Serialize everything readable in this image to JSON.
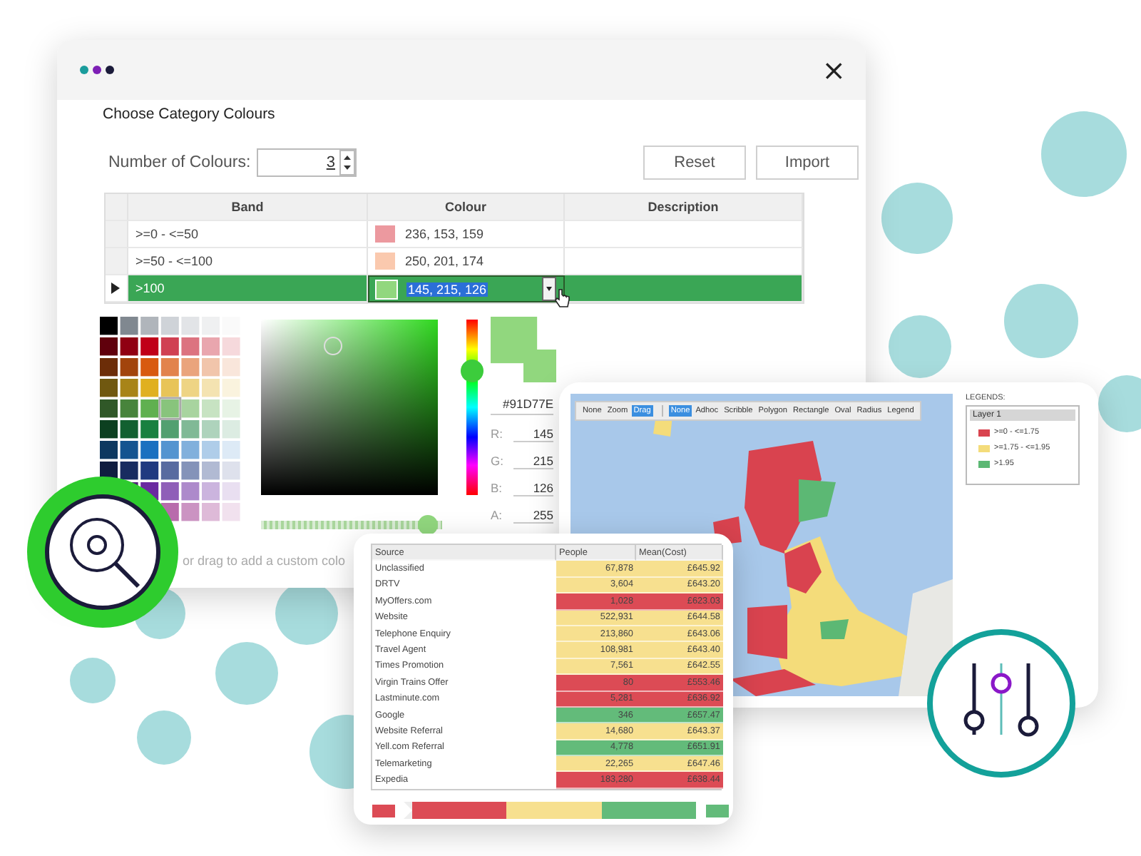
{
  "window": {
    "title": "Choose Category Colours",
    "close": "×"
  },
  "number_of_colours": {
    "label": "Number of Colours:",
    "value": "3"
  },
  "buttons": [
    "Reset",
    "Import"
  ],
  "band_table": {
    "columns": [
      "Band",
      "Colour",
      "Description"
    ],
    "rows": [
      {
        "band": ">=0 - <=50",
        "colour": "236, 153, 159",
        "color": "#ec999f",
        "selected": false
      },
      {
        "band": ">=50 - <=100",
        "colour": "250, 201, 174",
        "color": "#fac9ae",
        "selected": false
      },
      {
        "band": ">100",
        "colour": "145, 215, 126",
        "color": "#91d77e",
        "selected": true
      }
    ]
  },
  "color_picker": {
    "hue_slider": {
      "level": 0.71
    },
    "alpha_slider": {
      "level": 0.97
    },
    "hex": "#91D77E",
    "channels": [
      {
        "label": "R:",
        "value": "145"
      },
      {
        "label": "G:",
        "value": "215"
      },
      {
        "label": "B:",
        "value": "126"
      },
      {
        "label": "A:",
        "value": "255"
      }
    ],
    "hint": "or drag to add a custom colo"
  },
  "map_card": {
    "toolbar_groups": [
      [
        {
          "label": "None",
          "selected": false
        },
        {
          "label": "Zoom",
          "selected": false
        },
        {
          "label": "Drag",
          "selected": true
        }
      ],
      [
        {
          "label": "None",
          "selected": true
        },
        {
          "label": "Adhoc",
          "selected": false
        },
        {
          "label": "Scribble",
          "selected": false
        },
        {
          "label": "Polygon",
          "selected": false
        },
        {
          "label": "Rectangle",
          "selected": false
        },
        {
          "label": "Oval",
          "selected": false
        },
        {
          "label": "Radius",
          "selected": false
        },
        {
          "label": "Legend",
          "selected": false
        }
      ]
    ],
    "legend": {
      "heading": "LEGENDS:",
      "layer": "Layer 1",
      "items": [
        {
          "label": ">=0 - <=1.75",
          "color": "#d9434f"
        },
        {
          "label": ">=1.75 - <=1.95",
          "color": "#f4dc7a"
        },
        {
          "label": ">1.95",
          "color": "#5cb874"
        }
      ]
    }
  },
  "source_table": {
    "columns": [
      "Source",
      "People",
      "Mean(Cost)"
    ],
    "rows": [
      {
        "source": "Unclassified",
        "people": "67,878",
        "mean": "£645.92",
        "color": "#f7e08f"
      },
      {
        "source": "DRTV",
        "people": "3,604",
        "mean": "£643.20",
        "color": "#f7e08f"
      },
      {
        "source": "MyOffers.com",
        "people": "1,028",
        "mean": "£623.03",
        "color": "#dc4b55"
      },
      {
        "source": "Website",
        "people": "522,931",
        "mean": "£644.58",
        "color": "#f7e08f"
      },
      {
        "source": "Telephone Enquiry",
        "people": "213,860",
        "mean": "£643.06",
        "color": "#f7e08f"
      },
      {
        "source": "Travel Agent",
        "people": "108,981",
        "mean": "£643.40",
        "color": "#f7e08f"
      },
      {
        "source": "Times Promotion",
        "people": "7,561",
        "mean": "£642.55",
        "color": "#f7e08f"
      },
      {
        "source": "Virgin Trains Offer",
        "people": "80",
        "mean": "£553.46",
        "color": "#dc4b55"
      },
      {
        "source": "Lastminute.com",
        "people": "5,281",
        "mean": "£636.92",
        "color": "#dc4b55"
      },
      {
        "source": "Google",
        "people": "346",
        "mean": "£657.47",
        "color": "#63bb7a"
      },
      {
        "source": "Website Referral",
        "people": "14,680",
        "mean": "£643.37",
        "color": "#f7e08f"
      },
      {
        "source": "Yell.com Referral",
        "people": "4,778",
        "mean": "£651.91",
        "color": "#63bb7a"
      },
      {
        "source": "Telemarketing",
        "people": "22,265",
        "mean": "£647.46",
        "color": "#f7e08f"
      },
      {
        "source": "Expedia",
        "people": "183,280",
        "mean": "£638.44",
        "color": "#dc4b55"
      }
    ]
  }
}
